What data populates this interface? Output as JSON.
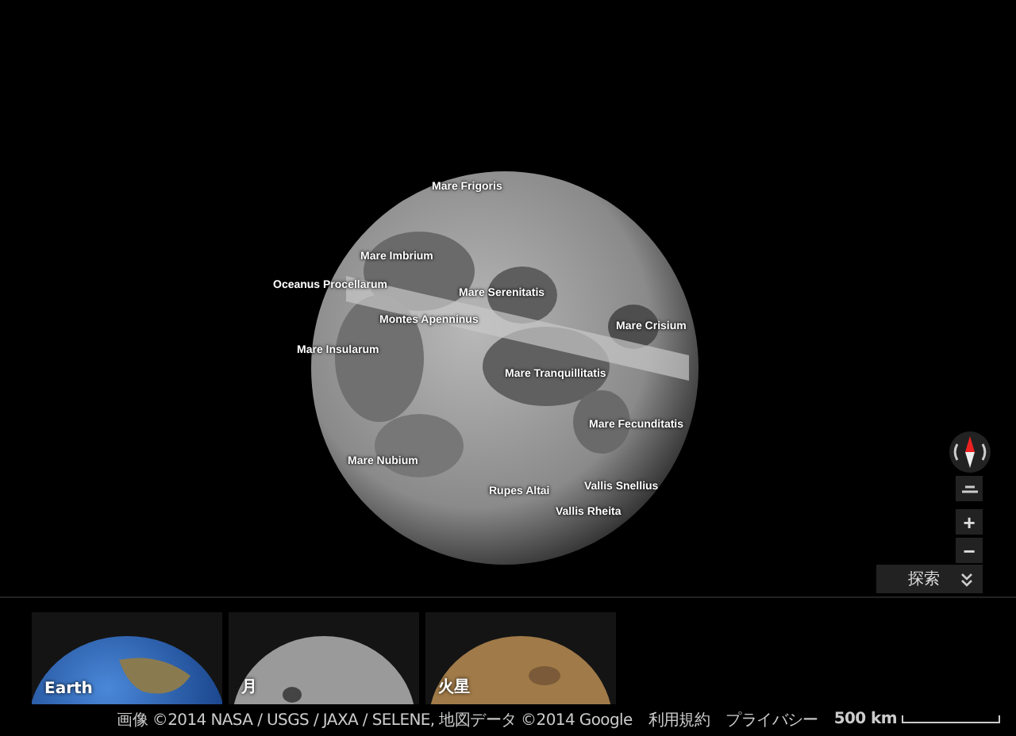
{
  "map_labels": [
    "Mare Frigoris",
    "Mare Imbrium",
    "Oceanus Procellarum",
    "Mare Serenitatis",
    "Montes Apenninus",
    "Mare Crisium",
    "Mare Insularum",
    "Mare Tranquillitatis",
    "Mare Fecunditatis",
    "Mare Nubium",
    "Rupes Altai",
    "Vallis Snellius",
    "Vallis Rheita"
  ],
  "controls": {
    "zoom_in": "+",
    "zoom_out": "−",
    "explore": "探索"
  },
  "planets": [
    {
      "kind": "earth",
      "label": "Earth"
    },
    {
      "kind": "moon",
      "label": "月"
    },
    {
      "kind": "mars",
      "label": "火星"
    }
  ],
  "footer": {
    "attribution": "画像 ©2014 NASA / USGS / JAXA / SELENE, 地図データ ©2014 Google",
    "links": [
      "利用規約",
      "プライバシー"
    ],
    "scale": "500 km"
  }
}
